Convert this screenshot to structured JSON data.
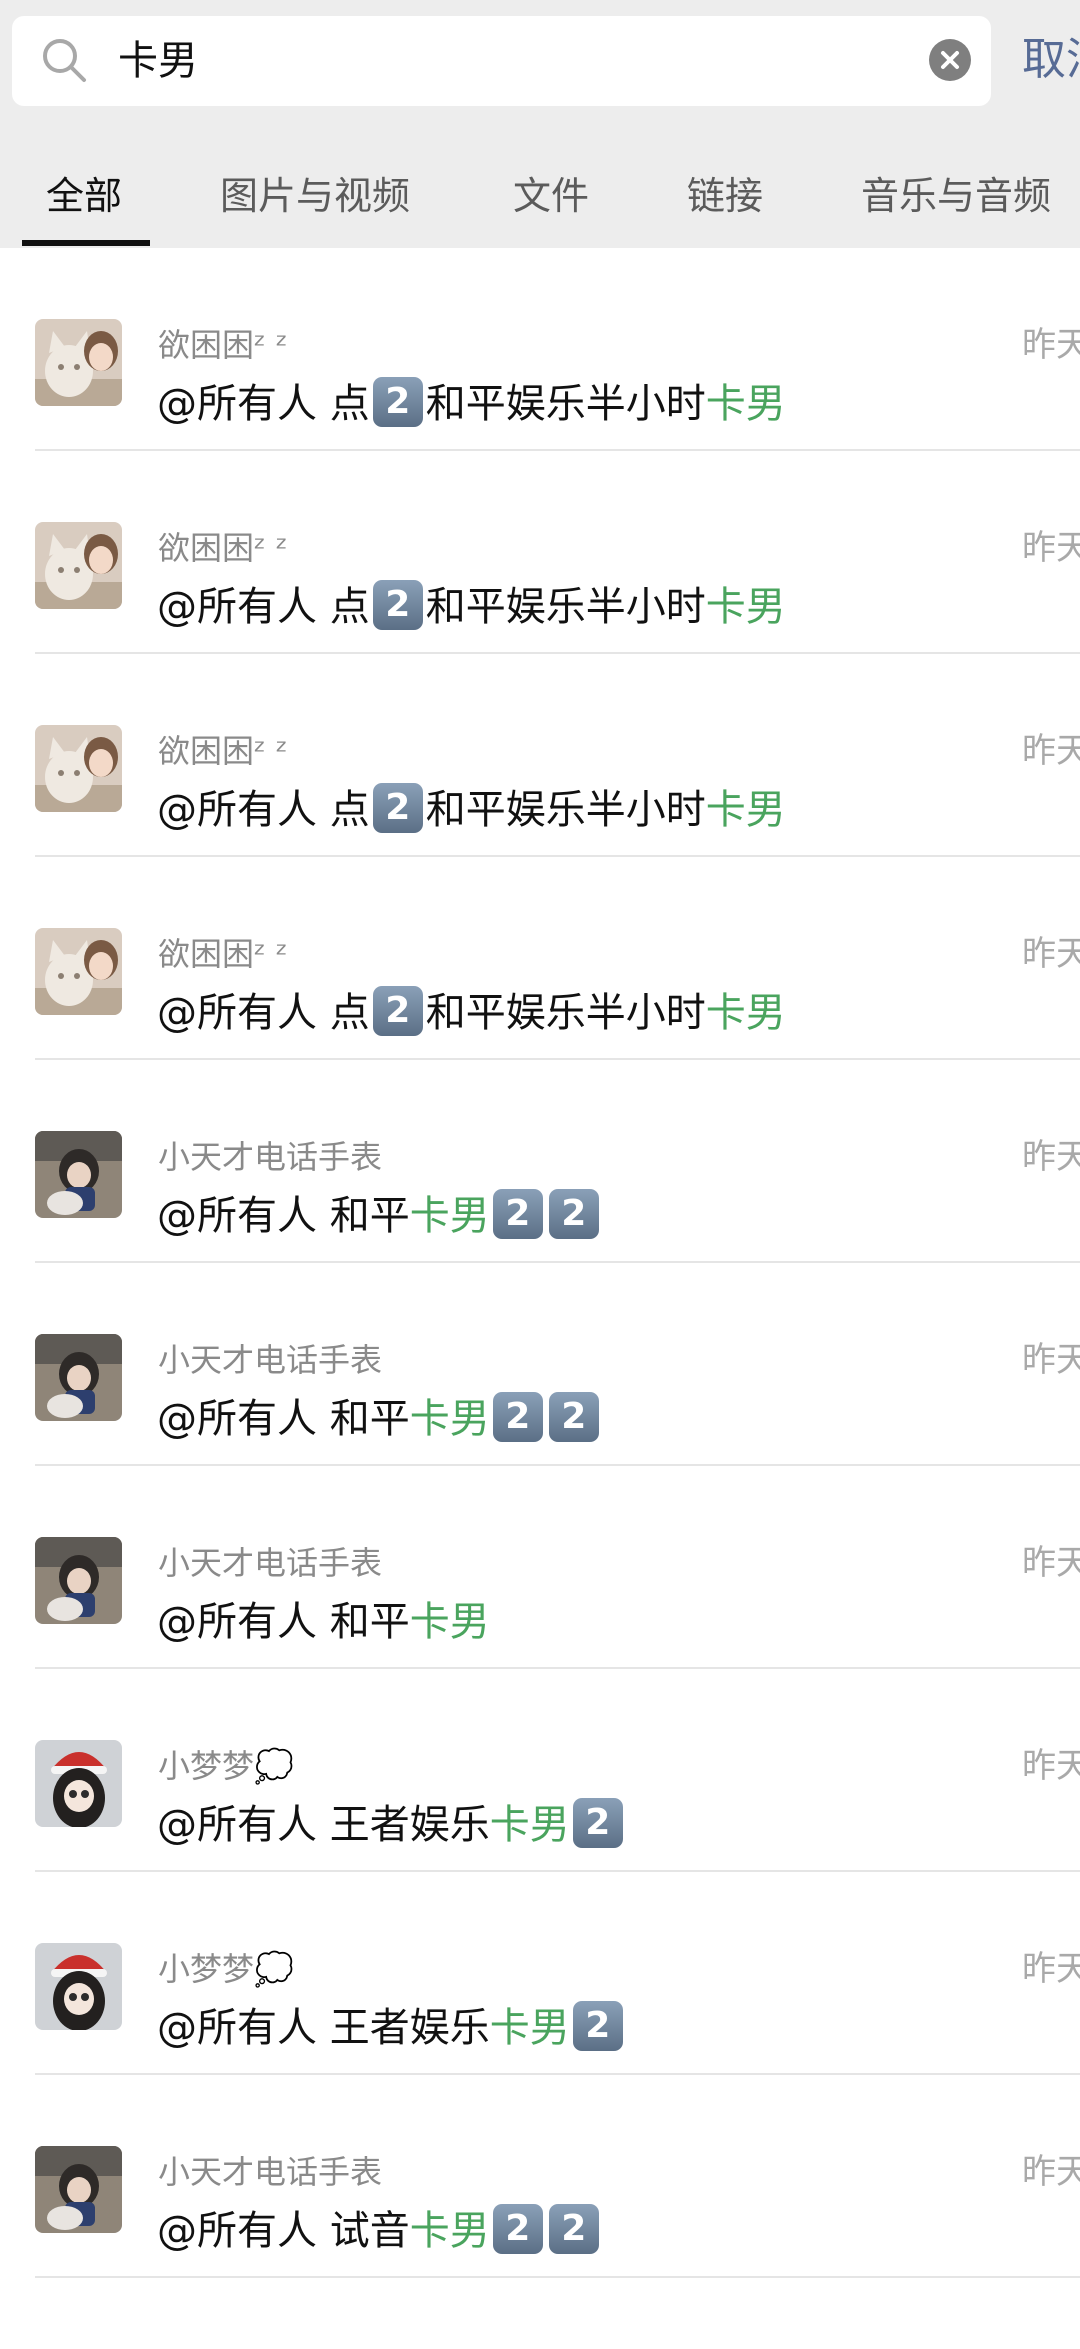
{
  "search": {
    "query": "卡男",
    "cancel_label": "取消"
  },
  "tabs": [
    {
      "label": "全部",
      "active": true
    },
    {
      "label": "图片与视频",
      "active": false
    },
    {
      "label": "文件",
      "active": false
    },
    {
      "label": "链接",
      "active": false
    },
    {
      "label": "音乐与音频",
      "active": false
    }
  ],
  "results": [
    {
      "sender": "欲困困ᶻ ᶻ",
      "avatar": "cat-girl-avatar",
      "time": "昨天",
      "parts": [
        {
          "t": "@所有人 点"
        },
        {
          "k": "2"
        },
        {
          "t": "和平娱乐半小时"
        },
        {
          "h": "卡男"
        }
      ]
    },
    {
      "sender": "欲困困ᶻ ᶻ",
      "avatar": "cat-girl-avatar",
      "time": "昨天",
      "parts": [
        {
          "t": "@所有人 点"
        },
        {
          "k": "2"
        },
        {
          "t": "和平娱乐半小时"
        },
        {
          "h": "卡男"
        }
      ]
    },
    {
      "sender": "欲困困ᶻ ᶻ",
      "avatar": "cat-girl-avatar",
      "time": "昨天",
      "parts": [
        {
          "t": "@所有人 点"
        },
        {
          "k": "2"
        },
        {
          "t": "和平娱乐半小时"
        },
        {
          "h": "卡男"
        }
      ]
    },
    {
      "sender": "欲困困ᶻ ᶻ",
      "avatar": "cat-girl-avatar",
      "time": "昨天",
      "parts": [
        {
          "t": "@所有人 点"
        },
        {
          "k": "2"
        },
        {
          "t": "和平娱乐半小时"
        },
        {
          "h": "卡男"
        }
      ]
    },
    {
      "sender": "小天才电话手表",
      "avatar": "girl-sitting-avatar",
      "time": "昨天",
      "parts": [
        {
          "t": "@所有人 和平"
        },
        {
          "h": "卡男"
        },
        {
          "k": "2"
        },
        {
          "k": "2"
        }
      ]
    },
    {
      "sender": "小天才电话手表",
      "avatar": "girl-sitting-avatar",
      "time": "昨天",
      "parts": [
        {
          "t": "@所有人 和平"
        },
        {
          "h": "卡男"
        },
        {
          "k": "2"
        },
        {
          "k": "2"
        }
      ]
    },
    {
      "sender": "小天才电话手表",
      "avatar": "girl-sitting-avatar",
      "time": "昨天",
      "parts": [
        {
          "t": "@所有人 和平"
        },
        {
          "h": "卡男"
        }
      ]
    },
    {
      "sender": "小梦梦💭",
      "avatar": "doll-santa-hat-avatar",
      "time": "昨天",
      "parts": [
        {
          "t": "@所有人 王者娱乐"
        },
        {
          "h": "卡男"
        },
        {
          "k": "2"
        }
      ]
    },
    {
      "sender": "小梦梦💭",
      "avatar": "doll-santa-hat-avatar",
      "time": "昨天",
      "parts": [
        {
          "t": "@所有人 王者娱乐"
        },
        {
          "h": "卡男"
        },
        {
          "k": "2"
        }
      ]
    },
    {
      "sender": "小天才电话手表",
      "avatar": "girl-sitting-avatar",
      "time": "昨天",
      "parts": [
        {
          "t": "@所有人 试音"
        },
        {
          "h": "卡男"
        },
        {
          "k": "2"
        },
        {
          "k": "2"
        }
      ]
    }
  ],
  "colors": {
    "highlight": "#4aa45e",
    "link": "#576b95",
    "header_bg": "#ededed",
    "keycap": "#6b7f96"
  }
}
